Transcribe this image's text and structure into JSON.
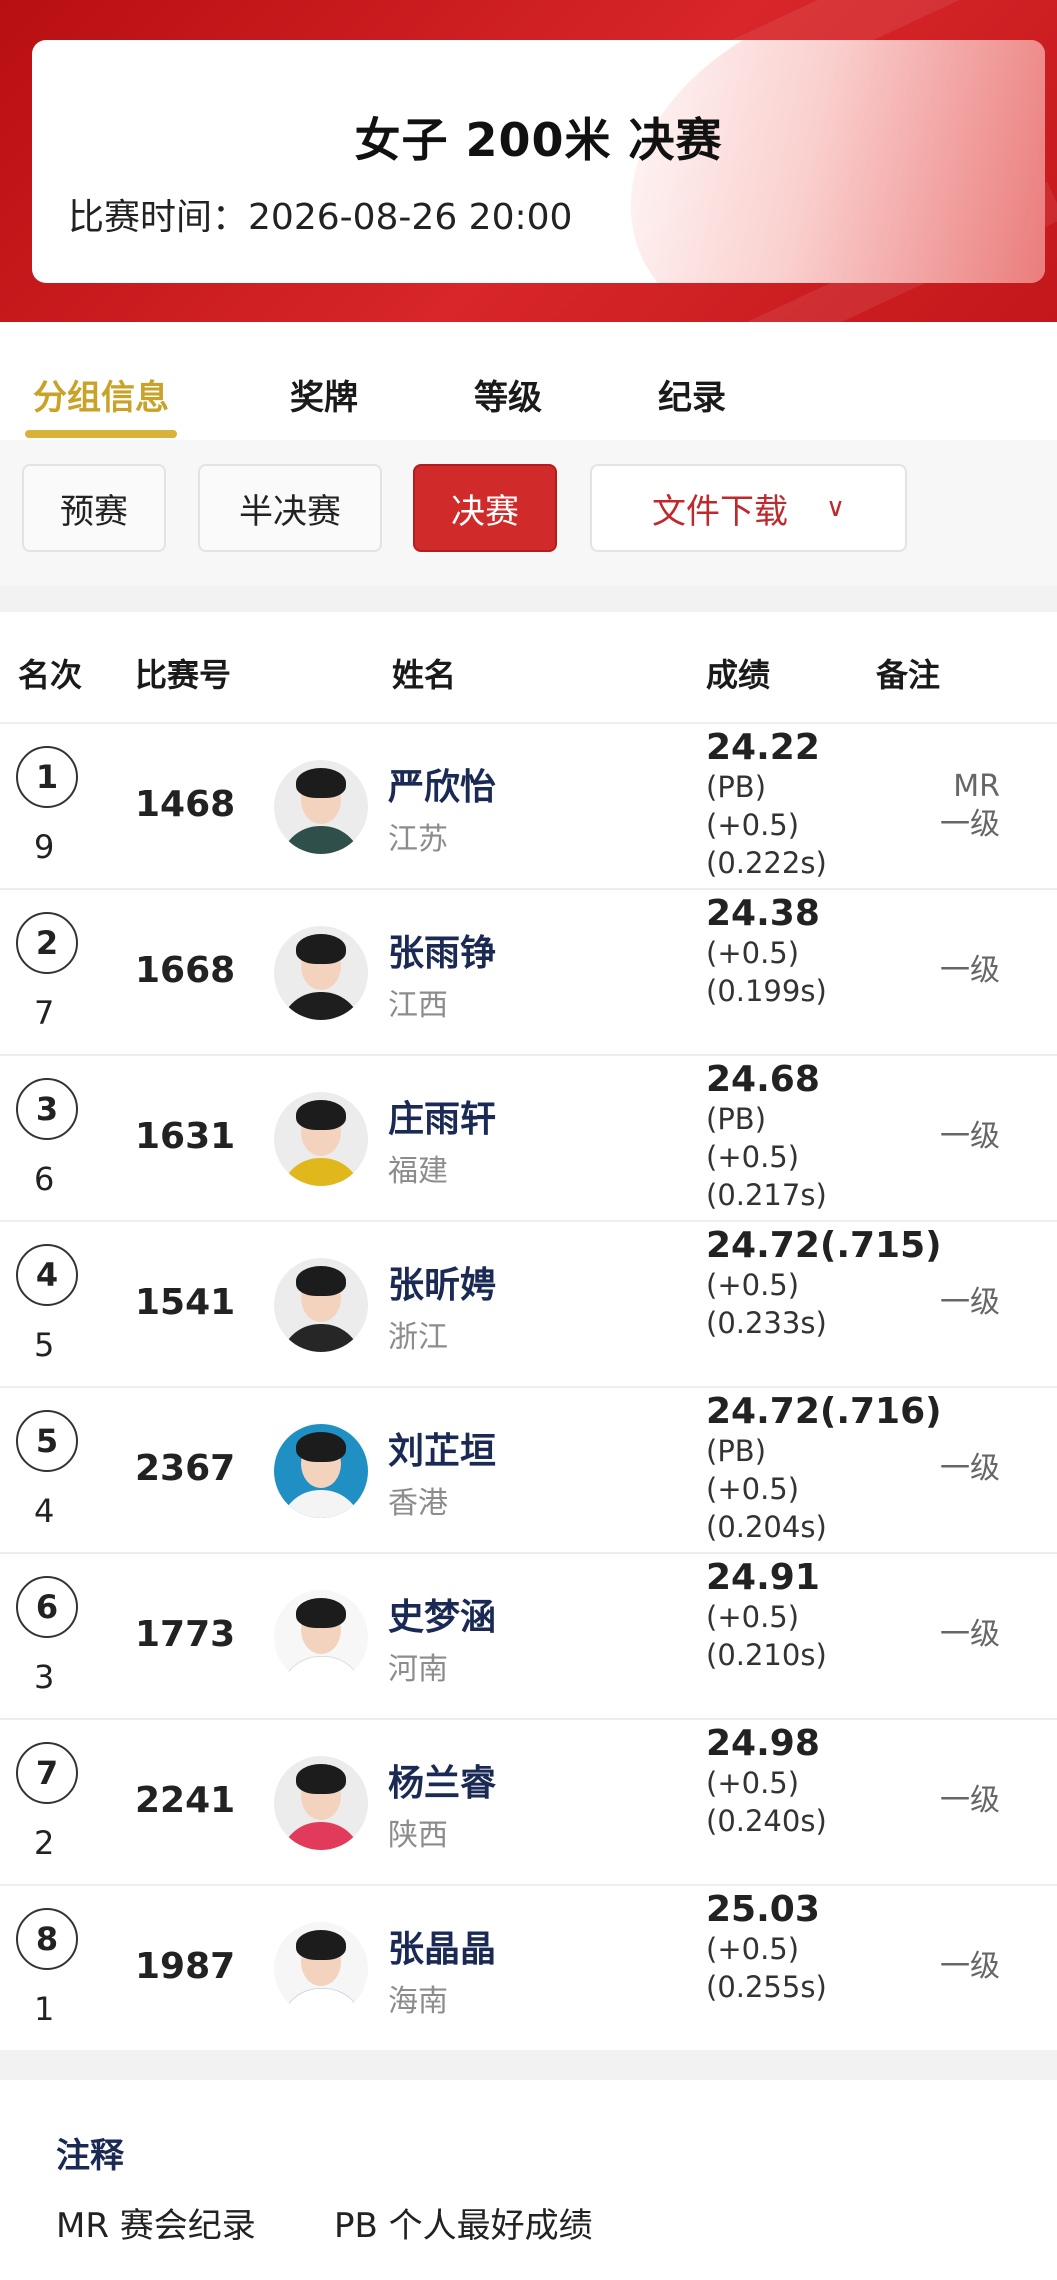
{
  "header": {
    "title": "女子 200米 决赛",
    "time_label": "比赛时间：",
    "time_value": "2026-08-26  20:00",
    "brand_color": "#c8181b"
  },
  "tabs": [
    {
      "label": "分组信息",
      "active": true
    },
    {
      "label": "奖牌",
      "active": false
    },
    {
      "label": "等级",
      "active": false
    },
    {
      "label": "纪录",
      "active": false
    }
  ],
  "filters": {
    "heats": "预赛",
    "semi": "半决赛",
    "final": "决赛",
    "download": "文件下载",
    "selected": "决赛"
  },
  "table": {
    "columns": [
      "名次",
      "比赛号",
      "姓名",
      "成绩",
      "备注"
    ],
    "rows": [
      {
        "rank": "1",
        "lane": "9",
        "bib": "1468",
        "name": "严欣怡",
        "province": "江苏",
        "result": "24.22",
        "pb": "(PB)",
        "wind": "(+0.5)",
        "reaction": "(0.222s)",
        "note1": "MR",
        "note2": "一级"
      },
      {
        "rank": "2",
        "lane": "7",
        "bib": "1668",
        "name": "张雨铮",
        "province": "江西",
        "result": "24.38",
        "pb": "",
        "wind": "(+0.5)",
        "reaction": "(0.199s)",
        "note1": "",
        "note2": "一级"
      },
      {
        "rank": "3",
        "lane": "6",
        "bib": "1631",
        "name": "庄雨轩",
        "province": "福建",
        "result": "24.68",
        "pb": "(PB)",
        "wind": "(+0.5)",
        "reaction": "(0.217s)",
        "note1": "",
        "note2": "一级"
      },
      {
        "rank": "4",
        "lane": "5",
        "bib": "1541",
        "name": "张昕娉",
        "province": "浙江",
        "result": "24.72(.715)",
        "pb": "",
        "wind": "(+0.5)",
        "reaction": "(0.233s)",
        "note1": "",
        "note2": "一级"
      },
      {
        "rank": "5",
        "lane": "4",
        "bib": "2367",
        "name": "刘芷垣",
        "province": "香港",
        "result": "24.72(.716)",
        "pb": "(PB)",
        "wind": "(+0.5)",
        "reaction": "(0.204s)",
        "note1": "",
        "note2": "一级"
      },
      {
        "rank": "6",
        "lane": "3",
        "bib": "1773",
        "name": "史梦涵",
        "province": "河南",
        "result": "24.91",
        "pb": "",
        "wind": "(+0.5)",
        "reaction": "(0.210s)",
        "note1": "",
        "note2": "一级"
      },
      {
        "rank": "7",
        "lane": "2",
        "bib": "2241",
        "name": "杨兰睿",
        "province": "陕西",
        "result": "24.98",
        "pb": "",
        "wind": "(+0.5)",
        "reaction": "(0.240s)",
        "note1": "",
        "note2": "一级"
      },
      {
        "rank": "8",
        "lane": "1",
        "bib": "1987",
        "name": "张晶晶",
        "province": "海南",
        "result": "25.03",
        "pb": "",
        "wind": "(+0.5)",
        "reaction": "(0.255s)",
        "note1": "",
        "note2": "一级"
      }
    ]
  },
  "footer": {
    "title": "注释",
    "items": [
      "MR 赛会纪录",
      "PB 个人最好成绩"
    ]
  }
}
